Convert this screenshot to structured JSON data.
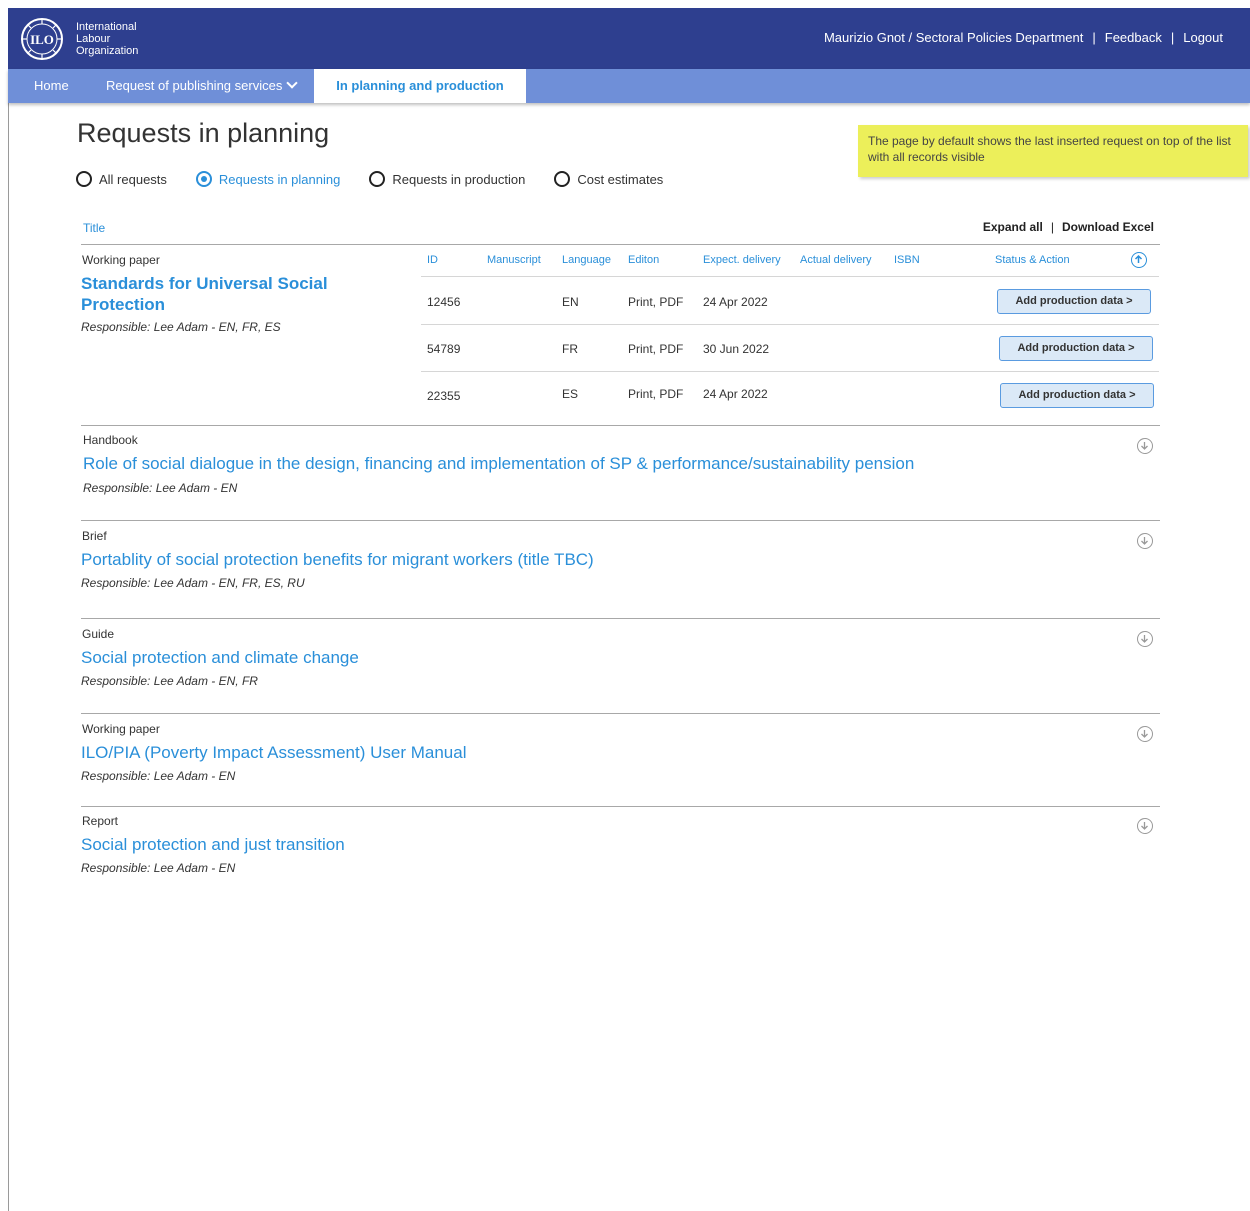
{
  "header": {
    "org_line1": "International",
    "org_line2": "Labour",
    "org_line3": "Organization",
    "user": "Maurizio Gnot / Sectoral Policies Department",
    "feedback": "Feedback",
    "logout": "Logout",
    "sep": "|"
  },
  "nav": {
    "home": "Home",
    "request": "Request of publishing services",
    "active": "In planning and production"
  },
  "page": {
    "title": "Requests in planning",
    "note": "The page by default shows the last inserted request on top of the list  with all records visible"
  },
  "filters": [
    {
      "label": "All requests",
      "selected": false
    },
    {
      "label": "Requests in planning",
      "selected": true
    },
    {
      "label": "Requests in production",
      "selected": false
    },
    {
      "label": "Cost estimates",
      "selected": false
    }
  ],
  "table": {
    "title_col": "Title",
    "expand_all": "Expand all",
    "sep": "|",
    "download": "Download Excel",
    "sub_headers": {
      "id": "ID",
      "manuscript": "Manuscript",
      "language": "Language",
      "edition": "Editon",
      "expect": "Expect. delivery",
      "actual": "Actual delivery",
      "isbn": "ISBN",
      "status": "Status & Action"
    }
  },
  "records": [
    {
      "type": "Working paper",
      "title_line1": "Standards for Universal Social",
      "title_line2": "Protection",
      "responsible": "Responsible: Lee Adam - EN, FR, ES",
      "rows": [
        {
          "id": "12456",
          "language": "EN",
          "edition": "Print, PDF",
          "expect": "24 Apr 2022",
          "action": "Add production data >"
        },
        {
          "id": "54789",
          "language": "FR",
          "edition": "Print, PDF",
          "expect": "30 Jun 2022",
          "action": "Add production data >"
        },
        {
          "id": "22355",
          "language": "ES",
          "edition": "Print, PDF",
          "expect": "24 Apr 2022",
          "action": "Add production data >"
        }
      ]
    },
    {
      "type": "Handbook",
      "title": "Role of social dialogue in the design, financing and implementation of SP & performance/sustainability pension",
      "responsible": "Responsible: Lee Adam - EN"
    },
    {
      "type": "Brief",
      "title": "Portablity of social protection benefits for migrant workers (title TBC)",
      "responsible": "Responsible: Lee Adam - EN, FR, ES, RU"
    },
    {
      "type": "Guide",
      "title": "Social protection and climate change",
      "responsible": "Responsible: Lee Adam - EN, FR"
    },
    {
      "type": "Working paper",
      "title": "ILO/PIA (Poverty Impact Assessment) User Manual",
      "responsible": "Responsible: Lee Adam - EN"
    },
    {
      "type": "Report",
      "title": "Social protection and just transition",
      "responsible": "Responsible: Lee Adam - EN"
    }
  ]
}
